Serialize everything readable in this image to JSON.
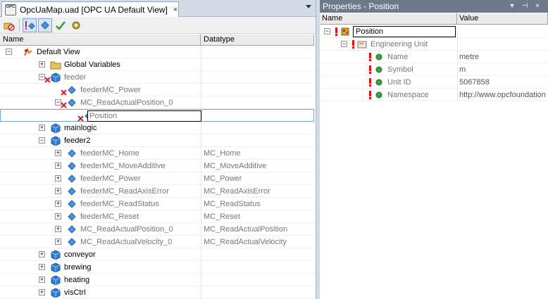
{
  "document_tab": {
    "title": "OpcUaMap.uad [OPC UA Default View]",
    "close": "×",
    "icon_text": "OPC"
  },
  "tree_columns": {
    "name": "Name",
    "datatype": "Datatype"
  },
  "tree_rows": [
    {
      "label": "Default View",
      "datatype": "",
      "expander": "−"
    },
    {
      "label": "Global Variables",
      "datatype": "",
      "expander": "+"
    },
    {
      "label": "feeder",
      "datatype": "",
      "expander": "−"
    },
    {
      "label": "feederMC_Power",
      "datatype": "",
      "expander": ""
    },
    {
      "label": "MC_ReadActualPosition_0",
      "datatype": "",
      "expander": "−"
    },
    {
      "label": "Position",
      "datatype": "",
      "expander": ""
    },
    {
      "label": "mainlogic",
      "datatype": "",
      "expander": "+"
    },
    {
      "label": "feeder2",
      "datatype": "",
      "expander": "−"
    },
    {
      "label": "feederMC_Home",
      "datatype": "MC_Home",
      "expander": "+"
    },
    {
      "label": "feederMC_MoveAdditive",
      "datatype": "MC_MoveAdditive",
      "expander": "+"
    },
    {
      "label": "feederMC_Power",
      "datatype": "MC_Power",
      "expander": "+"
    },
    {
      "label": "feederMC_ReadAxisError",
      "datatype": "MC_ReadAxisError",
      "expander": "+"
    },
    {
      "label": "feederMC_ReadStatus",
      "datatype": "MC_ReadStatus",
      "expander": "+"
    },
    {
      "label": "feederMC_Reset",
      "datatype": "MC_Reset",
      "expander": "+"
    },
    {
      "label": "MC_ReadActualPosition_0",
      "datatype": "MC_ReadActualPosition",
      "expander": "+"
    },
    {
      "label": "MC_ReadActualVelocity_0",
      "datatype": "MC_ReadActualVelocity",
      "expander": "+"
    },
    {
      "label": "conveyor",
      "datatype": "",
      "expander": "+"
    },
    {
      "label": "brewing",
      "datatype": "",
      "expander": "+"
    },
    {
      "label": "heating",
      "datatype": "",
      "expander": "+"
    },
    {
      "label": "visCtrl",
      "datatype": "",
      "expander": "+"
    }
  ],
  "properties_panel": {
    "title": "Properties - Position",
    "pin": "▾",
    "autohide": "⊣",
    "close": "×",
    "columns": {
      "name": "Name",
      "value": "Value"
    },
    "rows": [
      {
        "label": "Position",
        "value": "",
        "expander": "−"
      },
      {
        "label": "Engineering Unit",
        "value": "",
        "expander": "−"
      },
      {
        "label": "Name",
        "value": "metre",
        "expander": ""
      },
      {
        "label": "Symbol",
        "value": "m",
        "expander": ""
      },
      {
        "label": "Unit ID",
        "value": "5067858",
        "expander": ""
      },
      {
        "label": "Namespace",
        "value": "http://www.opcfoundation",
        "expander": ""
      }
    ]
  },
  "icons": {
    "toolbar": [
      "remove-mapping-icon",
      "enable-icon",
      "tag-icon",
      "check-icon",
      "settings-icon"
    ],
    "tree": [
      "view-icon",
      "folder-icon",
      "cube-icon",
      "variable-icon",
      "unmapped-x-icon"
    ],
    "properties": [
      "object-icon",
      "unit-icon",
      "property-icon"
    ]
  },
  "colors": {
    "cube": "#2f7fd6",
    "variable": "#4f8fdc",
    "unmapped_x": "#d62020",
    "folder": "#e9c35a",
    "property_dot": "#3ba33b",
    "excl": "#dd1111"
  }
}
